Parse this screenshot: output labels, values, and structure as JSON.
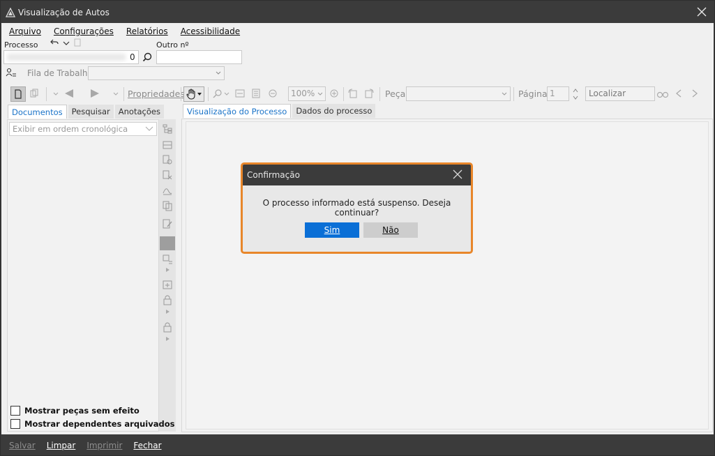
{
  "window": {
    "title": "Visualização de Autos"
  },
  "menu": [
    "Arquivo",
    "Configurações",
    "Relatórios",
    "Acessibilidade"
  ],
  "form": {
    "processo_label": "Processo",
    "processo_value_tail": "0",
    "outro_label": "Outro nº",
    "fila_label": "Fila de Trabalho"
  },
  "toolbar": {
    "properties_label": "Propriedades",
    "zoom_value": "100%",
    "peca_label": "Peça",
    "pagina_label": "Página",
    "pagina_value": "1",
    "search_placeholder": "Localizar"
  },
  "left_tabs": [
    "Documentos",
    "Pesquisar",
    "Anotações"
  ],
  "left_pane": {
    "order_select": "Exibir em ordem cronológica",
    "checkbox_no_effect": "Mostrar peças sem efeito",
    "checkbox_archived": "Mostrar dependentes arquivados"
  },
  "right_tabs": [
    "Visualização do Processo",
    "Dados do processo"
  ],
  "footer": [
    "Salvar",
    "Limpar",
    "Imprimir",
    "Fechar"
  ],
  "dialog": {
    "title": "Confirmação",
    "message": "O processo informado está suspenso. Deseja continuar?",
    "yes": "Sim",
    "no": "Não"
  },
  "colors": {
    "accent": "#0a6fd6",
    "dialog_border": "#e8862a",
    "titlebar": "#3b3b3b"
  }
}
